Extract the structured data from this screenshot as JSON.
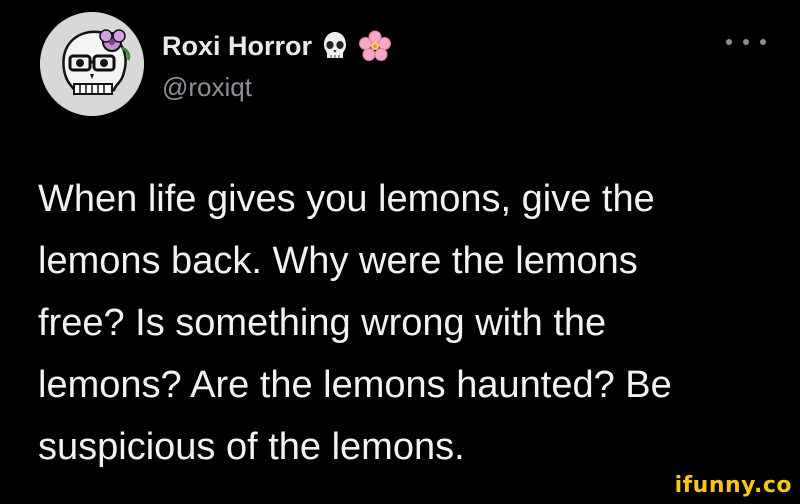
{
  "tweet": {
    "display_name": "Roxi Horror",
    "handle": "@roxiqt",
    "badges": [
      "skull-emoji",
      "cherry-blossom-emoji"
    ],
    "more_icon": "more-horizontal-icon",
    "text": "When life gives you lemons, give the\nlemons back. Why were the lemons\nfree? Is something wrong with the\nlemons? Are the lemons haunted? Be\nsuspicious of the lemons."
  },
  "watermark": {
    "text": "ifunny.co"
  },
  "colors": {
    "background": "#000000",
    "text": "#e7e9ea",
    "secondary": "#8b9096",
    "watermark": "#f5c518"
  }
}
